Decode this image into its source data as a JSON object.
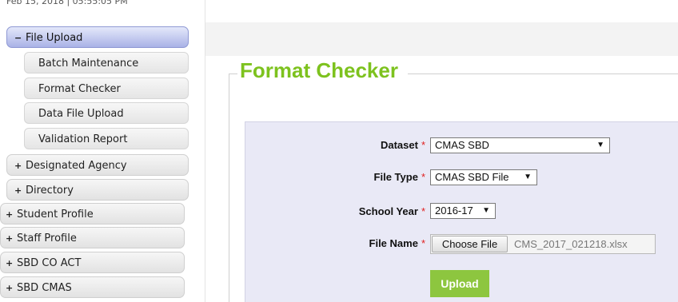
{
  "sidebar": {
    "timestamp": "Feb 15, 2018 | 05:55:05 PM",
    "file_upload": {
      "sign": "−",
      "label": "File Upload"
    },
    "sub_items": [
      "Batch Maintenance",
      "Format Checker",
      "Data File Upload",
      "Validation Report"
    ],
    "items": [
      {
        "sign": "+",
        "label": "Designated Agency"
      },
      {
        "sign": "+",
        "label": "Directory"
      },
      {
        "sign": "+",
        "label": "Student Profile"
      },
      {
        "sign": "+",
        "label": "Staff Profile"
      },
      {
        "sign": "+",
        "label": "SBD CO ACT"
      },
      {
        "sign": "+",
        "label": "SBD CMAS"
      }
    ]
  },
  "main": {
    "title": "Format Checker",
    "accent_color": "#7dc21e",
    "form": {
      "required_marker": "*",
      "dataset": {
        "label": "Dataset",
        "value": "CMAS SBD"
      },
      "file_type": {
        "label": "File Type",
        "value": "CMAS SBD File"
      },
      "school_year": {
        "label": "School Year",
        "value": "2016-17"
      },
      "file_name": {
        "label": "File Name",
        "button": "Choose File",
        "value": "CMS_2017_021218.xlsx"
      },
      "dropdown_icon": "▼",
      "upload_label": "Upload",
      "upload_color": "#8dc63f"
    }
  }
}
